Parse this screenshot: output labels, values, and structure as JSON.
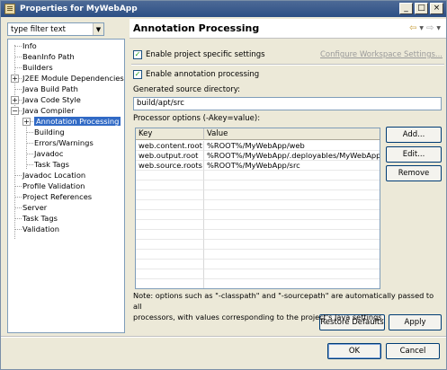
{
  "window": {
    "title": "Properties for MyWebApp",
    "controls": {
      "minimize": "_",
      "maximize": "□",
      "close": "×"
    }
  },
  "sidebar": {
    "filter_value": "type filter text",
    "items": [
      {
        "label": "Info",
        "expandable": false,
        "level": 0
      },
      {
        "label": "BeanInfo Path",
        "expandable": false,
        "level": 0
      },
      {
        "label": "Builders",
        "expandable": false,
        "level": 0
      },
      {
        "label": "J2EE Module Dependencies",
        "expandable": true,
        "expanded": false,
        "level": 0
      },
      {
        "label": "Java Build Path",
        "expandable": false,
        "level": 0
      },
      {
        "label": "Java Code Style",
        "expandable": true,
        "expanded": false,
        "level": 0
      },
      {
        "label": "Java Compiler",
        "expandable": true,
        "expanded": true,
        "level": 0
      },
      {
        "label": "Annotation Processing",
        "expandable": true,
        "expanded": false,
        "level": 1,
        "selected": true
      },
      {
        "label": "Building",
        "expandable": false,
        "level": 1
      },
      {
        "label": "Errors/Warnings",
        "expandable": false,
        "level": 1
      },
      {
        "label": "Javadoc",
        "expandable": false,
        "level": 1
      },
      {
        "label": "Task Tags",
        "expandable": false,
        "level": 1
      },
      {
        "label": "Javadoc Location",
        "expandable": false,
        "level": 0
      },
      {
        "label": "Profile Validation",
        "expandable": false,
        "level": 0
      },
      {
        "label": "Project References",
        "expandable": false,
        "level": 0
      },
      {
        "label": "Server",
        "expandable": false,
        "level": 0
      },
      {
        "label": "Task Tags",
        "expandable": false,
        "level": 0
      },
      {
        "label": "Validation",
        "expandable": false,
        "level": 0
      }
    ]
  },
  "main": {
    "title": "Annotation Processing",
    "enable_project_settings": {
      "label": "Enable project specific settings",
      "checked": true
    },
    "configure_link": "Configure Workspace Settings...",
    "enable_annotation": {
      "label": "Enable annotation processing",
      "checked": true
    },
    "generated_dir_label": "Generated source directory:",
    "generated_dir_value": "build/apt/src",
    "processor_options_label": "Processor options (-Akey=value):",
    "table": {
      "headers": [
        "Key",
        "Value"
      ],
      "rows": [
        {
          "key": "web.content.root",
          "value": "%ROOT%/MyWebApp/web"
        },
        {
          "key": "web.output.root",
          "value": "%ROOT%/MyWebApp/.deployables/MyWebApp"
        },
        {
          "key": "web.source.roots",
          "value": "%ROOT%/MyWebApp/src"
        }
      ]
    },
    "add_button": "Add...",
    "edit_button": "Edit...",
    "remove_button": "Remove",
    "note_line1": "Note: options such as \"-classpath\" and \"-sourcepath\" are automatically passed to all",
    "note_line2": "processors, with values corresponding to the project's Java settings.",
    "restore_button": "Restore Defaults",
    "apply_button": "Apply"
  },
  "footer": {
    "ok_button": "OK",
    "cancel_button": "Cancel"
  },
  "colors": {
    "selection": "#316ac5",
    "titlebar": "#2c4f85",
    "dialog_bg": "#ece9d8"
  }
}
